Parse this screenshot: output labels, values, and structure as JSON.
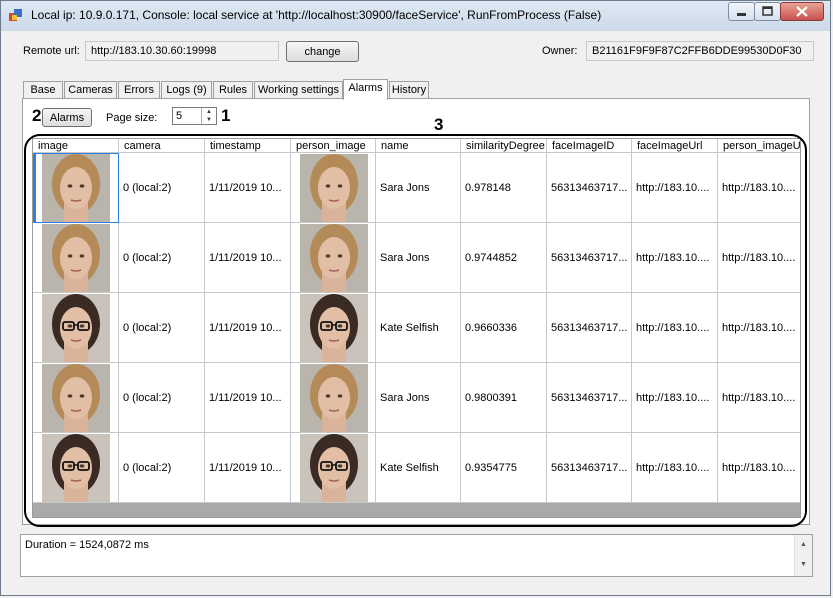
{
  "window": {
    "title": "Local ip: 10.9.0.171, Console: local service at 'http://localhost:30900/faceService', RunFromProcess (False)"
  },
  "header": {
    "remote_url_label": "Remote url:",
    "remote_url_value": "http://183.10.30.60:19998",
    "change_label": "change",
    "owner_label": "Owner:",
    "owner_value": "B21161F9F9F87C2FFB6DDE99530D0F30"
  },
  "tabs": [
    {
      "label": "Base"
    },
    {
      "label": "Cameras"
    },
    {
      "label": "Errors"
    },
    {
      "label": "Logs (9)"
    },
    {
      "label": "Rules"
    },
    {
      "label": "Working settings"
    },
    {
      "label": "Alarms",
      "active": true
    },
    {
      "label": "History"
    }
  ],
  "alarms": {
    "alarms_button": "Alarms",
    "page_size_label": "Page size:",
    "page_size_value": "5",
    "annotations": {
      "one": "1",
      "two": "2",
      "three": "3"
    },
    "columns": [
      "image",
      "camera",
      "timestamp",
      "person_image",
      "name",
      "similarityDegree",
      "faceImageID",
      "faceImageUrl",
      "person_imageUrl"
    ],
    "rows": [
      {
        "face": "blonde",
        "camera": "0 (local:2)",
        "timestamp": "1/11/2019 10...",
        "name": "Sara Jons",
        "similarity": "0.978148",
        "faceImageID": "56313463717...",
        "faceImageUrl": "http://183.10....",
        "person_imageUrl": "http://183.10...."
      },
      {
        "face": "blonde",
        "camera": "0 (local:2)",
        "timestamp": "1/11/2019 10...",
        "name": "Sara Jons",
        "similarity": "0.9744852",
        "faceImageID": "56313463717...",
        "faceImageUrl": "http://183.10....",
        "person_imageUrl": "http://183.10...."
      },
      {
        "face": "glasses",
        "camera": "0 (local:2)",
        "timestamp": "1/11/2019 10...",
        "name": "Kate Selfish",
        "similarity": "0.9660336",
        "faceImageID": "56313463717...",
        "faceImageUrl": "http://183.10....",
        "person_imageUrl": "http://183.10...."
      },
      {
        "face": "blonde",
        "camera": "0 (local:2)",
        "timestamp": "1/11/2019 10...",
        "name": "Sara Jons",
        "similarity": "0.9800391",
        "faceImageID": "56313463717...",
        "faceImageUrl": "http://183.10....",
        "person_imageUrl": "http://183.10...."
      },
      {
        "face": "glasses",
        "camera": "0 (local:2)",
        "timestamp": "1/11/2019 10...",
        "name": "Kate Selfish",
        "similarity": "0.9354775",
        "faceImageID": "56313463717...",
        "faceImageUrl": "http://183.10....",
        "person_imageUrl": "http://183.10...."
      }
    ]
  },
  "log": {
    "text": "Duration = 1524,0872 ms"
  },
  "icons": {
    "app": "app-icon",
    "minimize": "minimize-icon",
    "maximize": "maximize-icon",
    "close": "close-icon"
  },
  "colors": {
    "selection": "#2f7fe0",
    "grid_bg": "#a9a9a9"
  }
}
